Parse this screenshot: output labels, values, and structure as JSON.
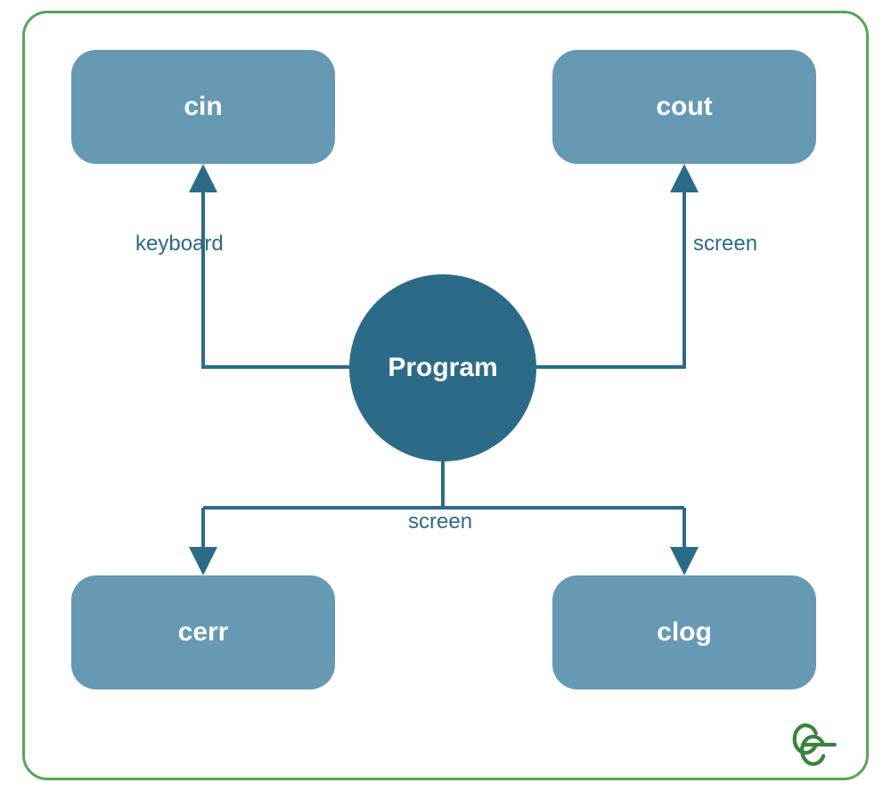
{
  "diagram": {
    "center": {
      "label": "Program"
    },
    "nodes": {
      "cin": {
        "label": "cin"
      },
      "cout": {
        "label": "cout"
      },
      "cerr": {
        "label": "cerr"
      },
      "clog": {
        "label": "clog"
      }
    },
    "edges": {
      "keyboard_label": "keyboard",
      "screen_top_label": "screen",
      "screen_bottom_label": "screen"
    },
    "colors": {
      "frame_border": "#5aa35a",
      "node_rect_bg": "#6699b3",
      "node_circle_bg": "#2c6b87",
      "text_light": "#ffffff",
      "edge_stroke": "#2c6b87",
      "logo_green": "#39833b"
    },
    "logo_alt": "GeeksforGeeks"
  }
}
